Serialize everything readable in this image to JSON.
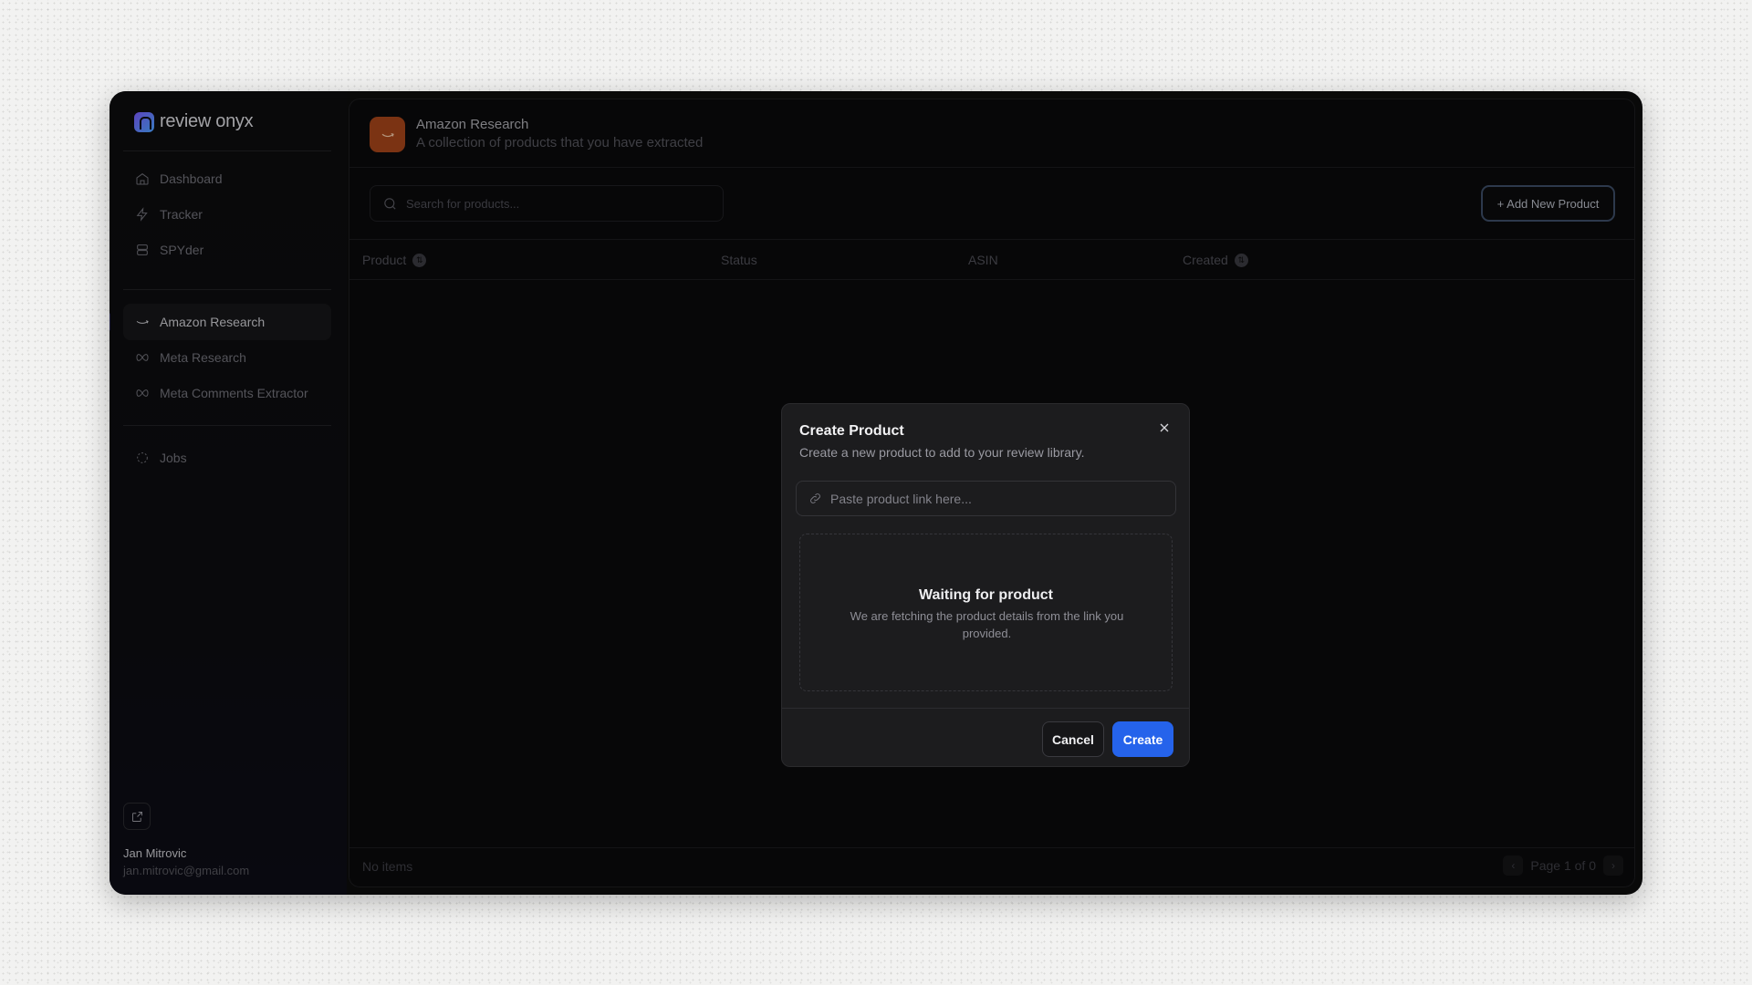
{
  "brand": {
    "name": "review onyx"
  },
  "sidebar": {
    "items": [
      {
        "label": "Dashboard",
        "icon": "home-icon"
      },
      {
        "label": "Tracker",
        "icon": "bolt-icon"
      },
      {
        "label": "SPYder",
        "icon": "database-icon"
      },
      {
        "label": "Amazon Research",
        "icon": "amazon-smile-icon",
        "active": true
      },
      {
        "label": "Meta Research",
        "icon": "meta-infinity-icon"
      },
      {
        "label": "Meta Comments Extractor",
        "icon": "meta-infinity-icon"
      },
      {
        "label": "Jobs",
        "icon": "loader-circle-icon"
      }
    ],
    "user": {
      "name": "Jan Mitrovic",
      "email": "jan.mitrovic@gmail.com"
    }
  },
  "header": {
    "title": "Amazon Research",
    "subtitle": "A collection of products that you have extracted"
  },
  "toolbar": {
    "search_placeholder": "Search for products...",
    "add_label": "+ Add New Product"
  },
  "table": {
    "columns": [
      "Product",
      "Status",
      "ASIN",
      "Created"
    ],
    "rows": []
  },
  "footer": {
    "items_text": "No items",
    "page_text": "Page 1 of 0"
  },
  "modal": {
    "title": "Create Product",
    "subtitle": "Create a new product to add to your review library.",
    "input_placeholder": "Paste product link here...",
    "waiting_title": "Waiting for product",
    "waiting_text": "We are fetching the product details from the link you provided.",
    "cancel_label": "Cancel",
    "create_label": "Create"
  },
  "colors": {
    "accent": "#2563eb",
    "amazon_icon_bg": "#a4451a"
  }
}
